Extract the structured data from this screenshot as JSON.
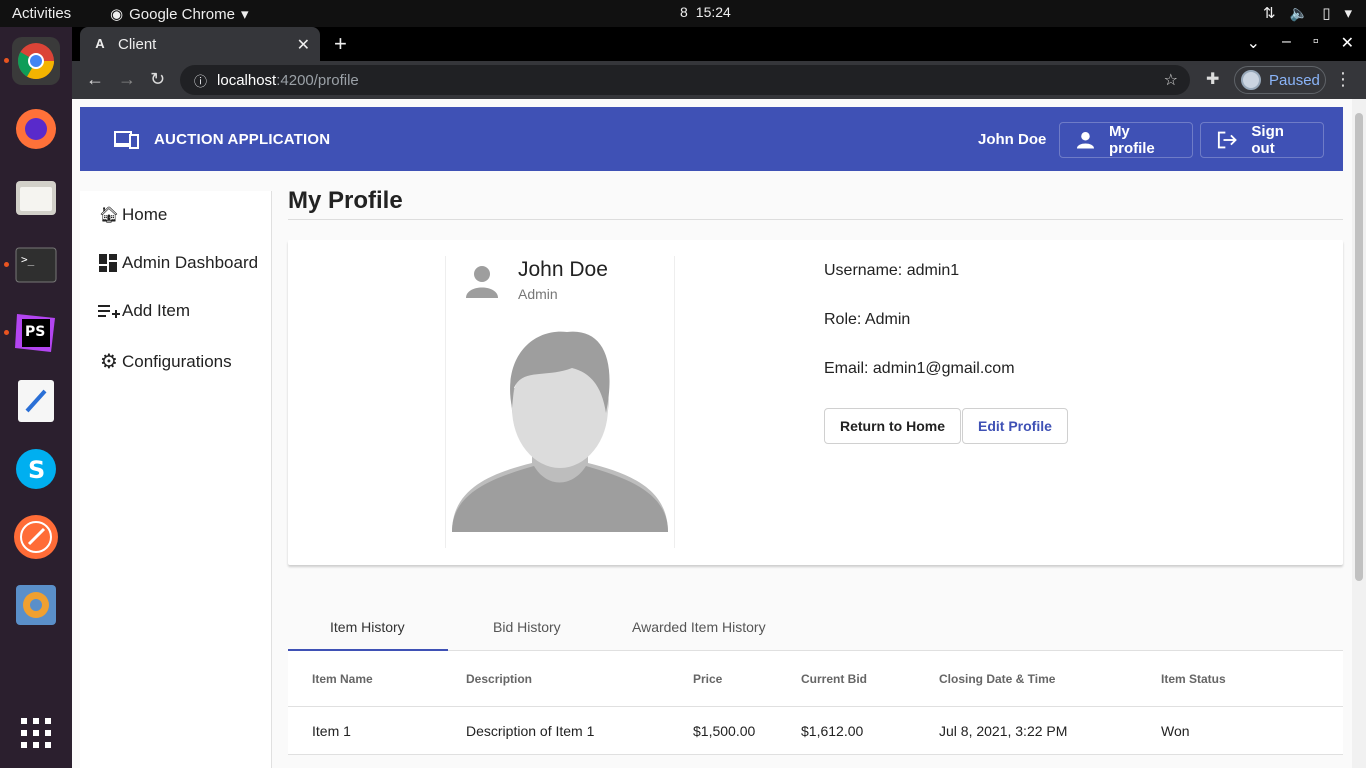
{
  "topbar": {
    "activities": "Activities",
    "app": "Google Chrome",
    "clock_a": "8",
    "clock_b": "15:24"
  },
  "chrome": {
    "tab_title": "Client",
    "url_host": "localhost",
    "url_path": ":4200/profile",
    "paused": "Paused"
  },
  "app": {
    "brand": "AUCTION APPLICATION",
    "user_name": "John Doe",
    "my_profile": "My profile",
    "sign_out": "Sign out",
    "brand_color": "#3f51b5"
  },
  "sidenav": [
    {
      "label": "Home",
      "icon": "home-icon"
    },
    {
      "label": "Admin Dashboard",
      "icon": "dashboard-icon"
    },
    {
      "label": "Add Item",
      "icon": "playlist-add-icon"
    },
    {
      "label": "Configurations",
      "icon": "gear-icon"
    }
  ],
  "page": {
    "title": "My Profile",
    "profile": {
      "name": "John Doe",
      "role": "Admin",
      "username_line": "Username: admin1",
      "role_line": "Role: Admin",
      "email_line": "Email: admin1@gmail.com",
      "return_home": "Return to Home",
      "edit_profile": "Edit Profile"
    },
    "tabs": [
      "Item History",
      "Bid History",
      "Awarded Item History"
    ],
    "table": {
      "headers": [
        "Item Name",
        "Description",
        "Price",
        "Current Bid",
        "Closing Date & Time",
        "Item Status"
      ],
      "rows": [
        [
          "Item 1",
          "Description of Item 1",
          "$1,500.00",
          "$1,612.00",
          "Jul 8, 2021, 3:22 PM",
          "Won"
        ]
      ]
    }
  }
}
